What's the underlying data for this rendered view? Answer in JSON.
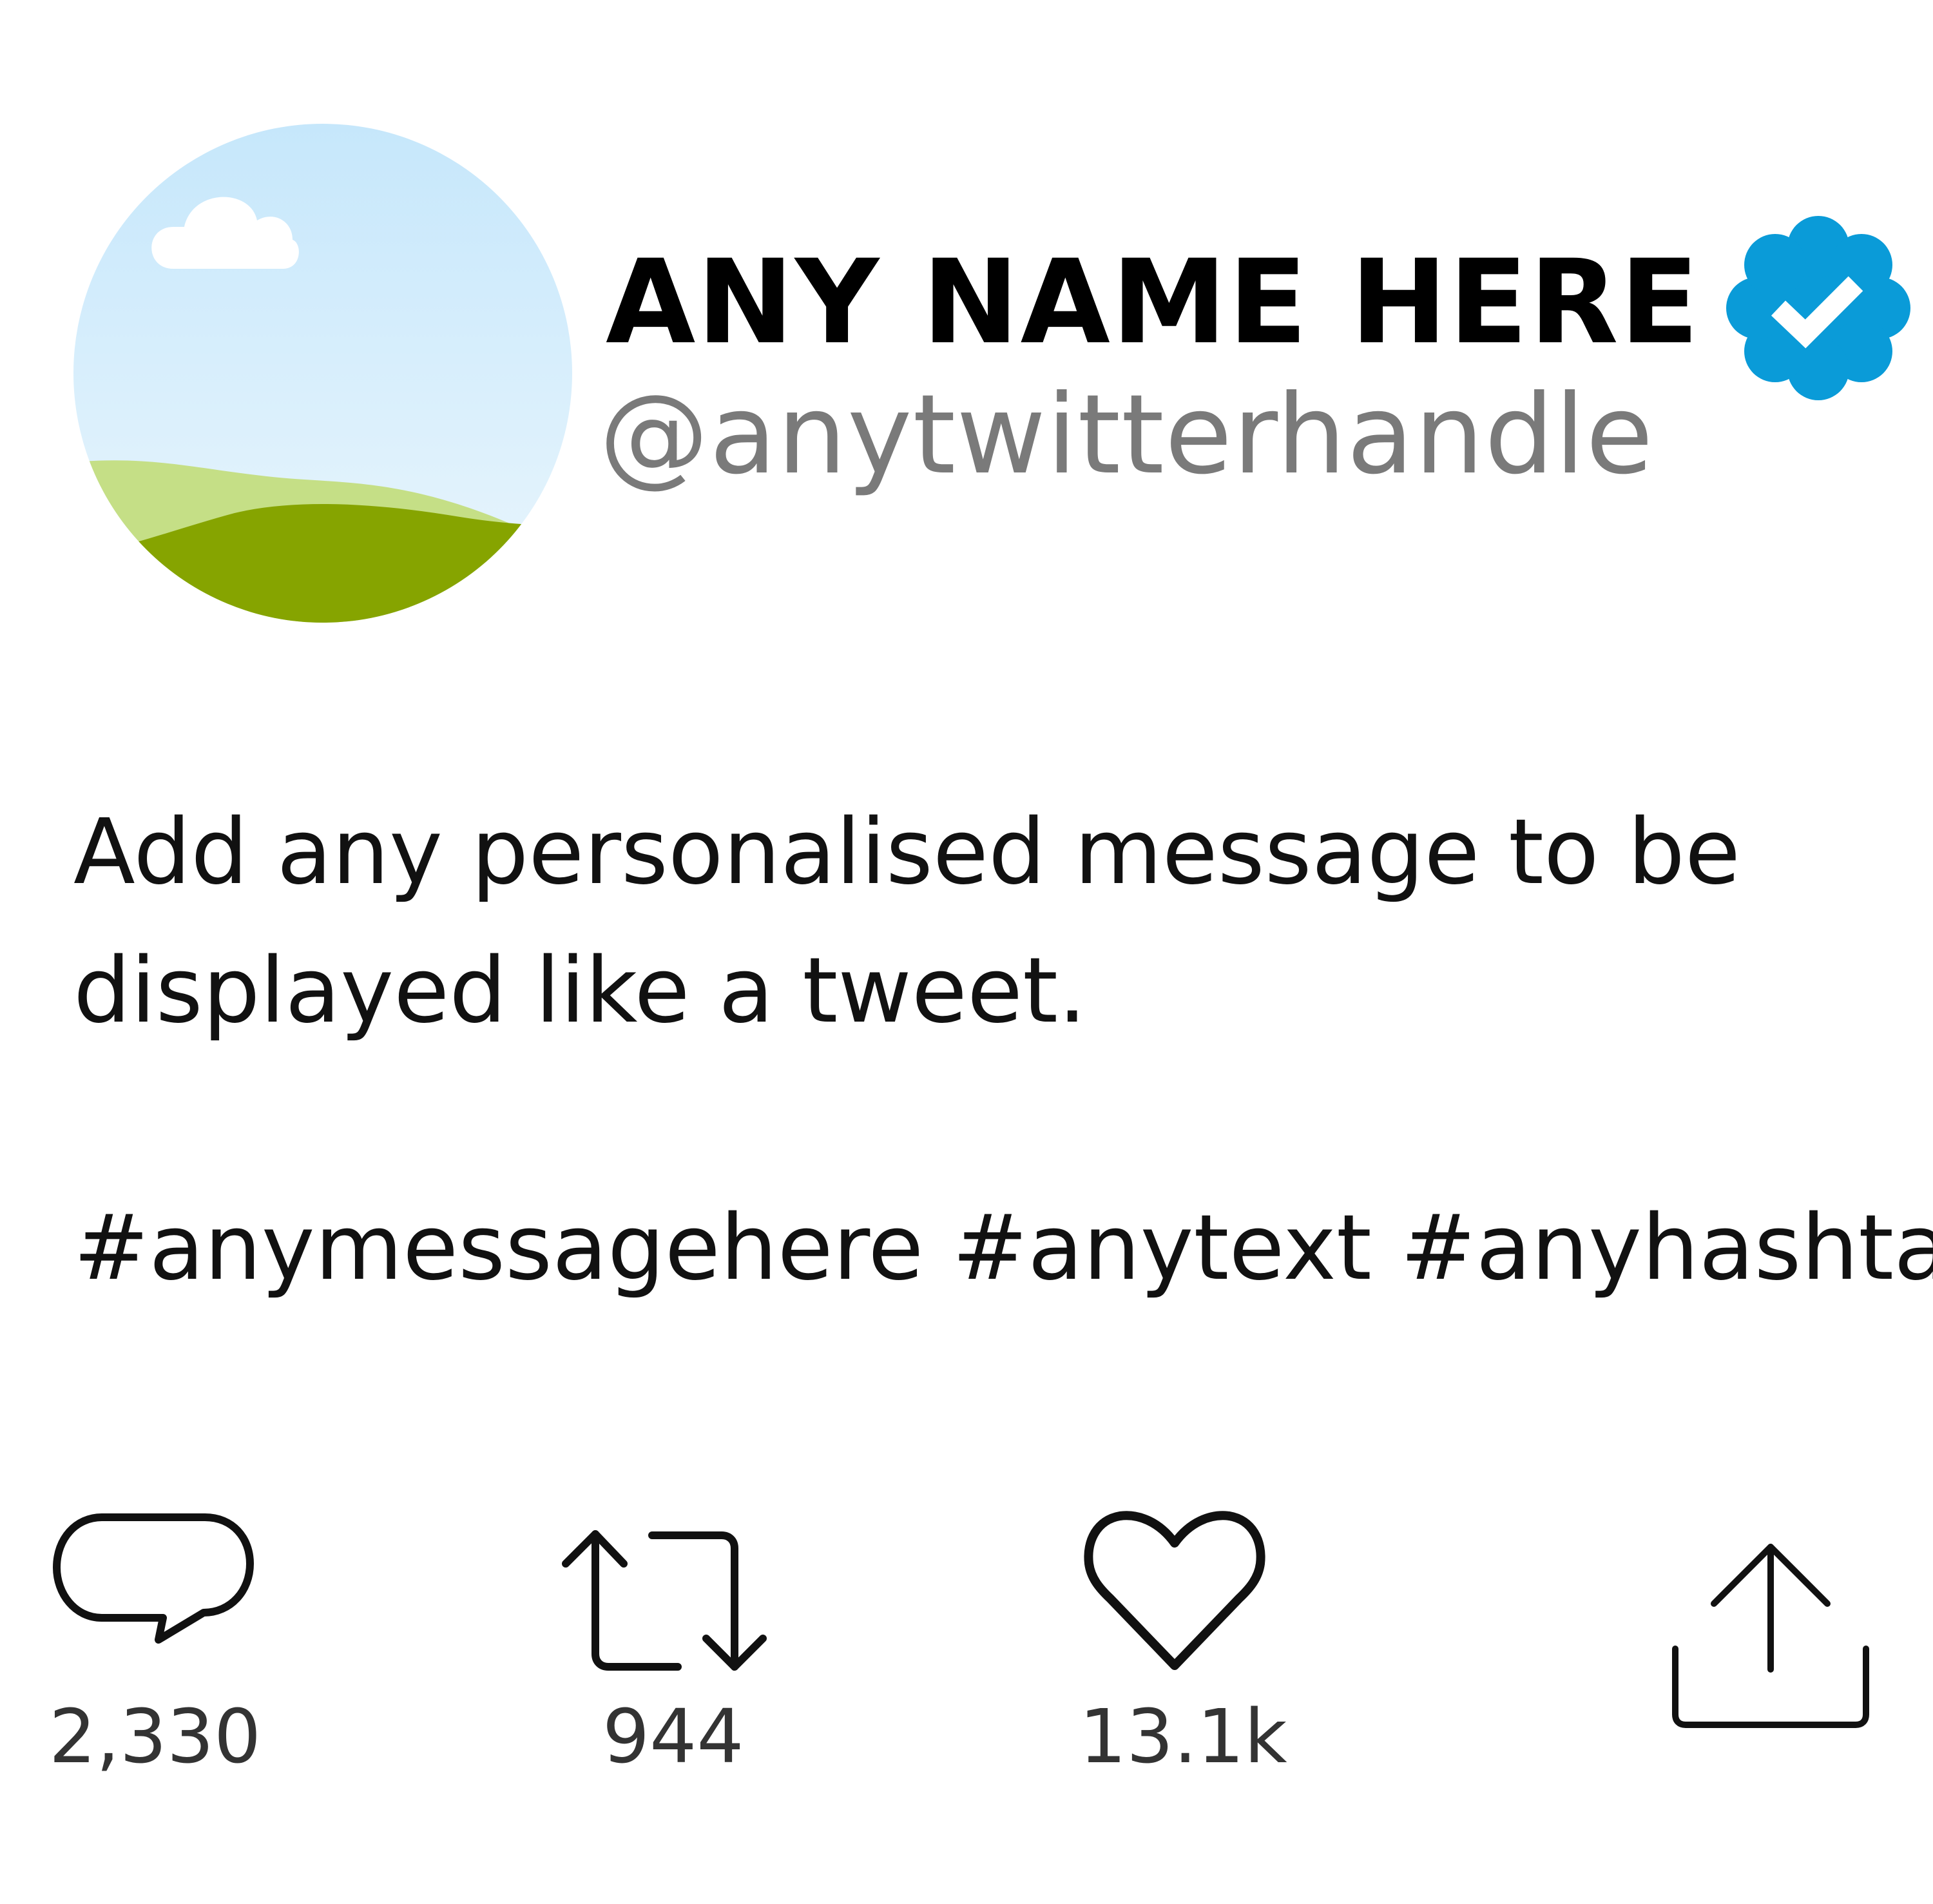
{
  "profile": {
    "name": "ANY NAME HERE",
    "handle": "@anytwitterhandle",
    "avatar_icon": "landscape-avatar-icon",
    "verified_icon": "verified-badge-icon"
  },
  "tweet": {
    "message": "Add any personalised message to be displayed like a tweet.",
    "hashtags": "#anymessagehere #anytext #anyhashtag"
  },
  "actions": {
    "reply": {
      "icon": "reply-bubble-icon",
      "count": "2,330"
    },
    "retweet": {
      "icon": "retweet-icon",
      "count": "944"
    },
    "like": {
      "icon": "heart-icon",
      "count": "13.1k"
    },
    "share": {
      "icon": "share-upload-icon"
    }
  },
  "colors": {
    "verified": "#0a9bd8",
    "handle": "#7a7a7a",
    "sky_top": "#c6e7fb",
    "hill_light": "#c5df86",
    "hill_dark": "#86a400"
  }
}
